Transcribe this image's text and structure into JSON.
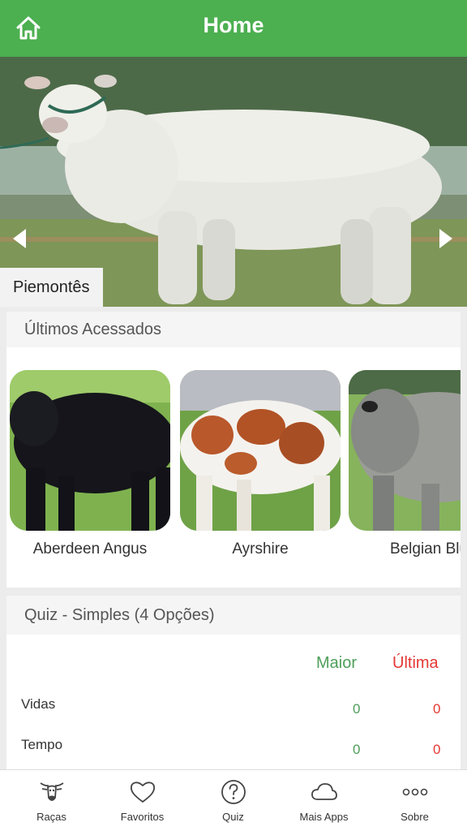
{
  "header": {
    "title": "Home",
    "home_icon": "home-icon"
  },
  "hero": {
    "caption": "Piemontês",
    "prev_icon": "chevron-left-icon",
    "next_icon": "chevron-right-icon"
  },
  "recent": {
    "title": "Últimos Acessados",
    "items": [
      {
        "name": "Aberdeen Angus"
      },
      {
        "name": "Ayrshire"
      },
      {
        "name": "Belgian Blu"
      }
    ]
  },
  "quiz": {
    "title": "Quiz - Simples (4 Opções)",
    "col_best": "Maior",
    "col_last": "Última",
    "rows": [
      {
        "label": "Vidas",
        "best": "0",
        "last": "0"
      },
      {
        "label": "Tempo",
        "best": "0",
        "last": "0"
      }
    ]
  },
  "tabs": [
    {
      "label": "Raças",
      "icon": "cow-icon"
    },
    {
      "label": "Favoritos",
      "icon": "heart-icon"
    },
    {
      "label": "Quiz",
      "icon": "question-icon"
    },
    {
      "label": "Mais Apps",
      "icon": "cloud-icon"
    },
    {
      "label": "Sobre",
      "icon": "more-dots-icon"
    }
  ],
  "colors": {
    "primary": "#4caf50",
    "best": "#4e9e5a",
    "last": "#e53935"
  }
}
